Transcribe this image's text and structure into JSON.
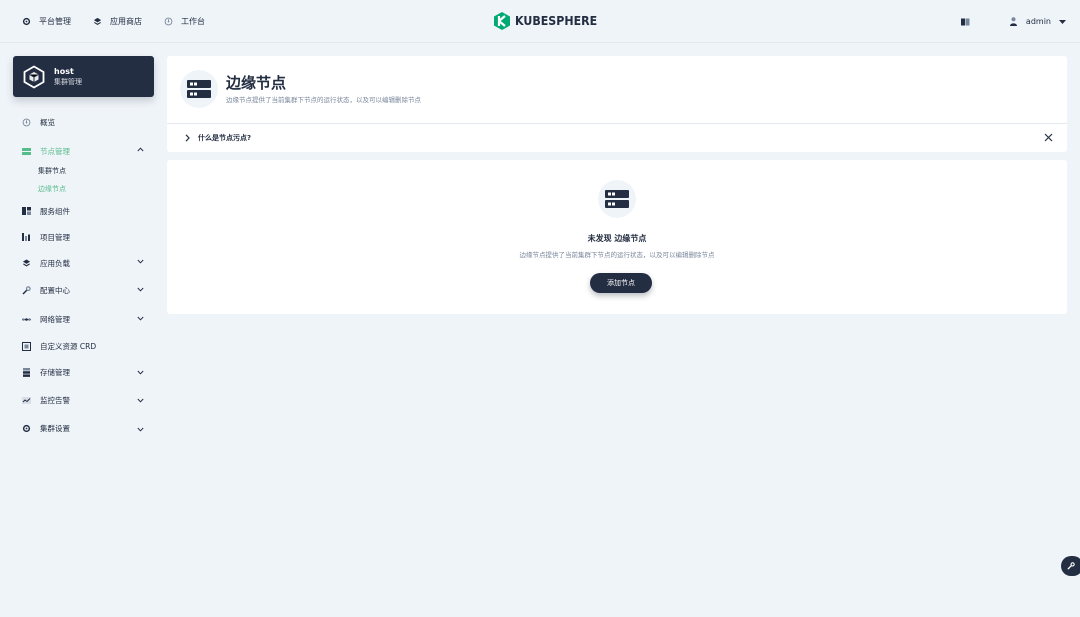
{
  "topnav": [
    {
      "label": "平台管理",
      "icon": "gear-icon"
    },
    {
      "label": "应用商店",
      "icon": "layers-icon"
    },
    {
      "label": "工作台",
      "icon": "dashboard-icon"
    }
  ],
  "brand": {
    "name": "KUBESPHERE",
    "color": "#00aa72"
  },
  "user": {
    "name": "admin"
  },
  "cluster": {
    "name": "host",
    "subtitle": "集群管理"
  },
  "menu": {
    "overview": "概览",
    "nodes": "节点管理",
    "nodes_sub": [
      "集群节点",
      "边缘节点"
    ],
    "components": "服务组件",
    "projects": "项目管理",
    "workloads": "应用负载",
    "config": "配置中心",
    "network": "网络管理",
    "crd": "自定义资源 CRD",
    "storage": "存储管理",
    "monitoring": "监控告警",
    "settings": "集群设置"
  },
  "header": {
    "title": "边缘节点",
    "description": "边缘节点提供了当前集群下节点的运行状态，以及可以编辑删除节点",
    "tip": "什么是节点污点?"
  },
  "empty": {
    "title": "未发现 边缘节点",
    "description": "边缘节点提供了当前集群下节点的运行状态，以及可以编辑删除节点",
    "button": "添加节点"
  },
  "colors": {
    "accent": "#55bc8a",
    "dark": "#242e42",
    "background": "#eff4f9"
  }
}
